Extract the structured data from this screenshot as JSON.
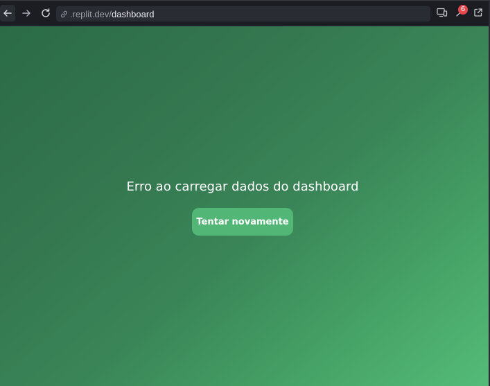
{
  "browser": {
    "url_domain": ".replit.dev/",
    "url_path": "dashboard",
    "notification_count": "6",
    "icons": [
      "back-arrow-icon",
      "forward-arrow-icon",
      "reload-icon",
      "link-icon",
      "devices-icon",
      "tools-icon",
      "external-link-icon"
    ]
  },
  "page": {
    "error_message": "Erro ao carregar dados do dashboard",
    "retry_label": "Tentar novamente"
  },
  "colors": {
    "accent_button": "#52b776",
    "background_gradient_start": "#2b6c47",
    "background_gradient_end": "#54bb78",
    "badge": "#e5484d"
  }
}
